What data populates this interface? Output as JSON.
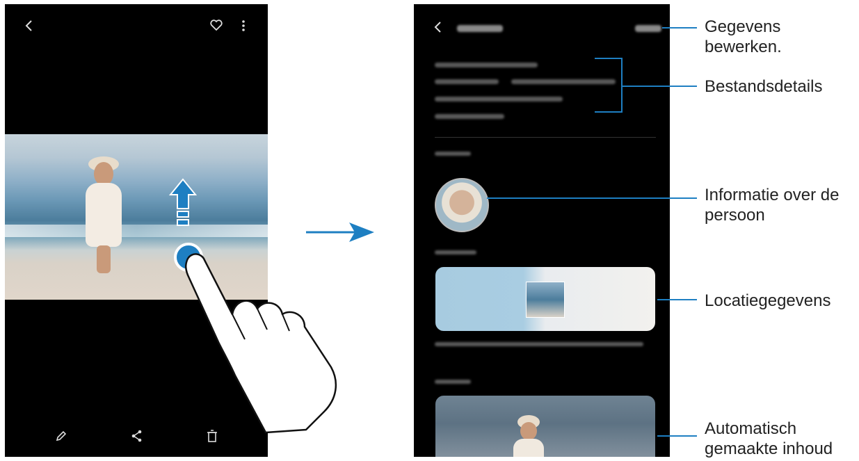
{
  "callouts": {
    "edit_details": {
      "line1": "Gegevens",
      "line2": "bewerken."
    },
    "file_details": "Bestandsdetails",
    "person_info": {
      "line1": "Informatie over de",
      "line2": "persoon"
    },
    "location": "Locatiegegevens",
    "auto_content": {
      "line1": "Automatisch",
      "line2": "gemaakte inhoud"
    }
  },
  "icons": {
    "back": "chevron-left-icon",
    "favorite": "heart-icon",
    "more": "more-vertical-icon",
    "edit": "pencil-icon",
    "share": "share-icon",
    "delete": "trash-icon"
  },
  "colors": {
    "accent": "#1e7fc2",
    "phone_bg": "#000000"
  }
}
